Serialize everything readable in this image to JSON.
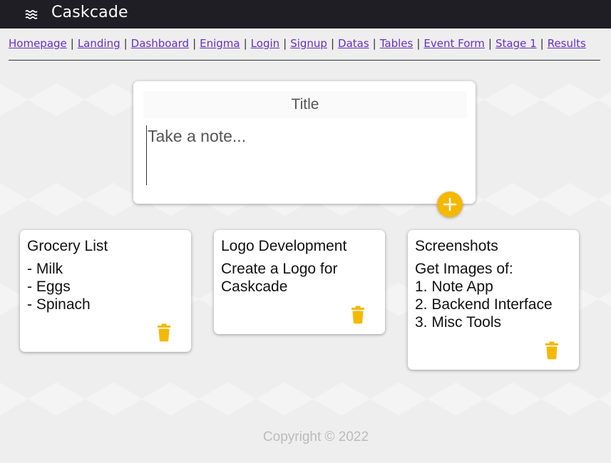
{
  "app": {
    "brand": "Caskcade",
    "menu_icon": "menu-waves-icon"
  },
  "nav": {
    "links": [
      "Homepage",
      "Landing",
      "Dashboard",
      "Enigma",
      "Login",
      "Signup",
      "Datas",
      "Tables",
      "Event Form",
      "Stage 1",
      "Results"
    ],
    "separator": "|"
  },
  "composer": {
    "title_placeholder": "Title",
    "note_placeholder": "Take a note...",
    "add_icon": "plus-icon",
    "accent_color": "#f5b800"
  },
  "notes": [
    {
      "title": "Grocery List",
      "body": "- Milk\n- Eggs\n- Spinach",
      "delete_icon": "trash-icon"
    },
    {
      "title": "Logo Development",
      "body": "Create a Logo for\nCaskcade",
      "delete_icon": "trash-icon"
    },
    {
      "title": "Screenshots",
      "body": "Get Images of:\n1. Note App\n2. Backend Interface\n3. Misc Tools",
      "delete_icon": "trash-icon"
    }
  ],
  "footer": {
    "copyright": "Copyright © 2022"
  },
  "colors": {
    "topbar": "#1e1e24",
    "link": "#6a2fc2",
    "accent": "#f5b800"
  }
}
